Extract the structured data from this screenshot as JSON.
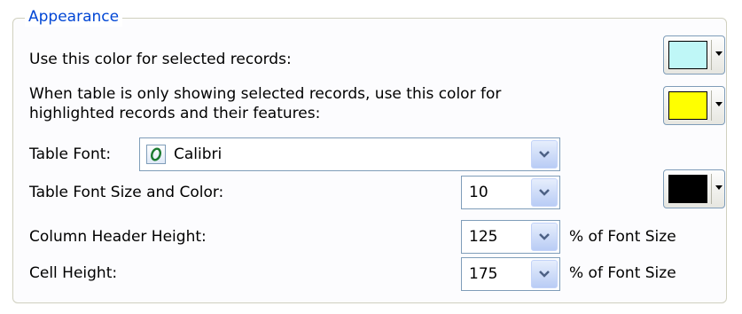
{
  "group": {
    "title": "Appearance"
  },
  "selected_color": {
    "label": "Use this color for selected records:",
    "color": "#bff7f7"
  },
  "highlight_color": {
    "label_line1": "When table is only showing selected records, use this color for",
    "label_line2": "highlighted records and their features:",
    "color": "#ffff00"
  },
  "table_font": {
    "label": "Table Font:",
    "value": "Calibri"
  },
  "font_size_color": {
    "label": "Table Font Size and Color:",
    "size_value": "10",
    "color": "#000000"
  },
  "column_header_height": {
    "label": "Column Header Height:",
    "value": "125",
    "suffix": "% of Font Size"
  },
  "cell_height": {
    "label": "Cell Height:",
    "value": "175",
    "suffix": "% of Font Size"
  },
  "icons": {
    "font_type": "opentype-font-icon",
    "dropdown": "chevron-down-icon",
    "color_caret": "caret-down-icon"
  }
}
